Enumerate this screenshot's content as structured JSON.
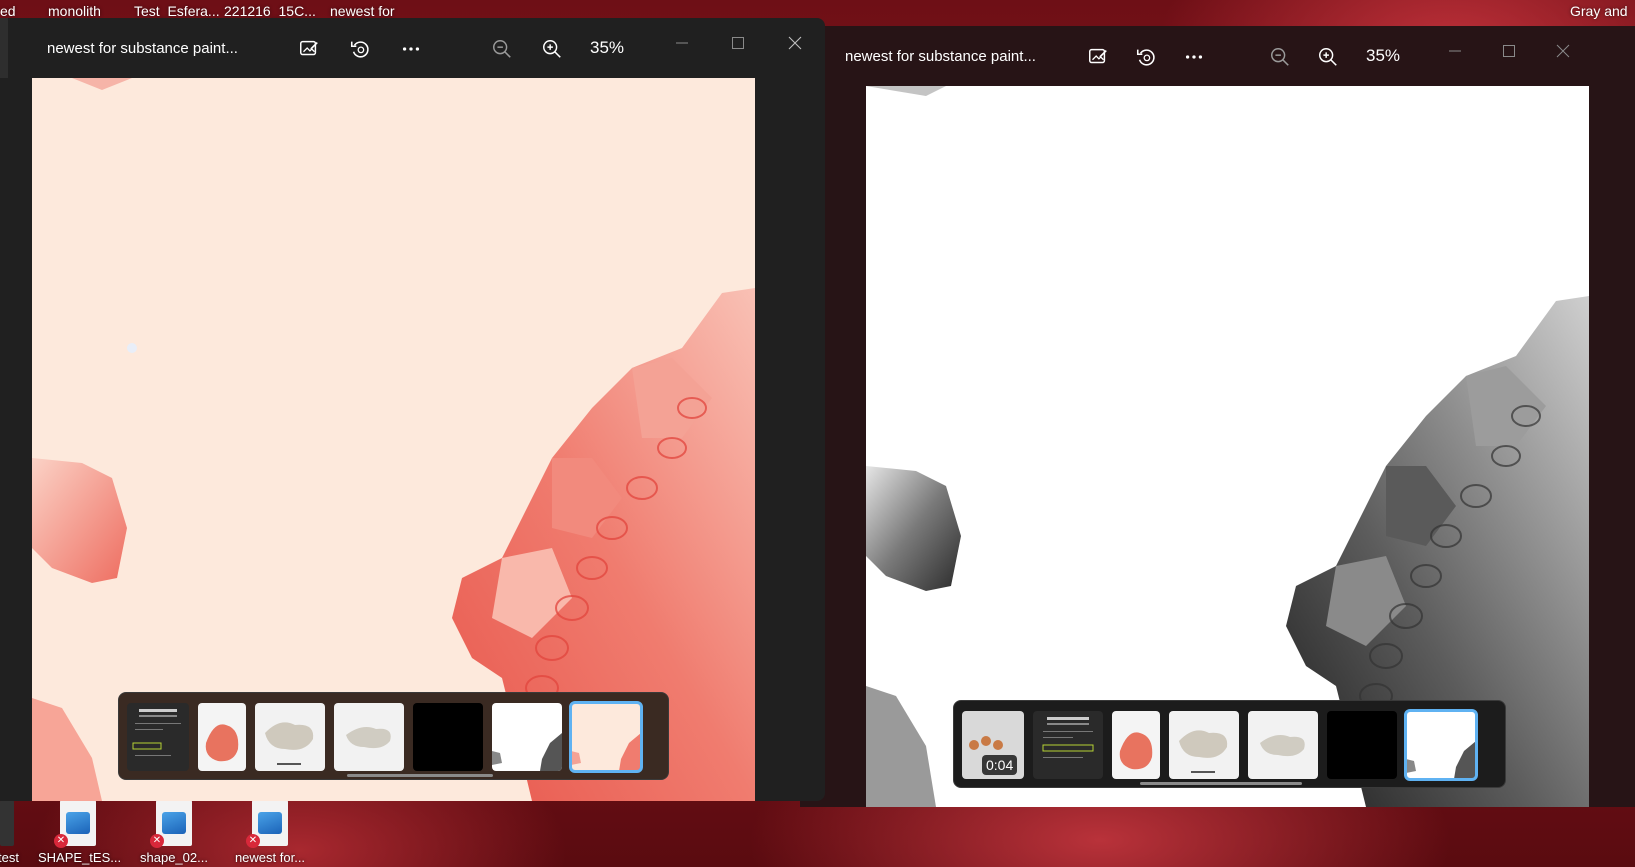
{
  "desktop_top_labels": [
    "ed",
    "monolith",
    "Test_Esfera...",
    "221216_15C...",
    "newest for",
    "Gray and"
  ],
  "window_left": {
    "title": "newest for substance paint...",
    "zoom": "35%",
    "filmstrip": {
      "thumbnails": [
        "document",
        "pink-object",
        "gray-sculpture",
        "gray-sculpture",
        "black",
        "gray-shape",
        "pink-shape"
      ],
      "selected_index": 6
    }
  },
  "window_right": {
    "title": "newest for substance paint...",
    "zoom": "35%",
    "filmstrip": {
      "video_duration": "0:04",
      "thumbnails": [
        "video",
        "document",
        "pink-object",
        "gray-sculpture",
        "gray-sculpture",
        "black",
        "gray-shape"
      ],
      "selected_index": 6
    }
  },
  "desktop_icons": [
    {
      "label": "SHAPE_tES..."
    },
    {
      "label": "shape_02..."
    },
    {
      "label": "newest for..."
    }
  ],
  "desktop_edge_label": "test",
  "colors": {
    "accent": "#5fb2f2",
    "canvas_left": "#fde9dc",
    "shape_pink": "#f07c6f",
    "window_bg": "#202020"
  }
}
